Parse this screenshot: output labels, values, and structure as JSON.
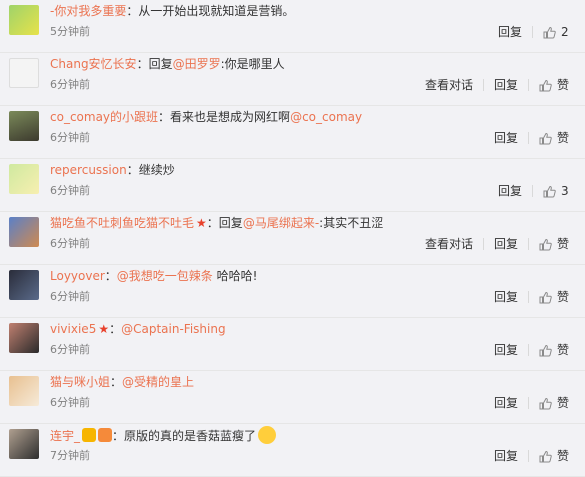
{
  "actions": {
    "view_conversation": "查看对话",
    "reply": "回复",
    "like_label": "赞"
  },
  "comments": [
    {
      "user": "-你对我多重要",
      "sep": "：",
      "content": [
        {
          "t": "plain",
          "v": "从一开始出现就知道是营销。"
        }
      ],
      "time": "5分钟前",
      "likes": "2"
    },
    {
      "user": "Chang安忆长安",
      "sep": "：",
      "content": [
        {
          "t": "plain",
          "v": "回复"
        },
        {
          "t": "mention",
          "v": "@田罗罗"
        },
        {
          "t": "plain",
          "v": ":你是哪里人"
        }
      ],
      "time": "6分钟前",
      "view_conversation": true
    },
    {
      "user": "co_comay的小跟班",
      "sep": "：",
      "content": [
        {
          "t": "plain",
          "v": "看来也是想成为网红啊"
        },
        {
          "t": "mention",
          "v": "@co_comay"
        }
      ],
      "time": "6分钟前"
    },
    {
      "user": "repercussion",
      "sep": "：",
      "content": [
        {
          "t": "plain",
          "v": "继续炒"
        }
      ],
      "time": "6分钟前",
      "likes": "3"
    },
    {
      "user": "猫吃鱼不吐刺鱼吃猫不吐毛",
      "sep": "：",
      "star": true,
      "content": [
        {
          "t": "plain",
          "v": "回复"
        },
        {
          "t": "mention",
          "v": "@马尾绑起来-"
        },
        {
          "t": "plain",
          "v": ":其实不丑涩"
        }
      ],
      "time": "6分钟前",
      "view_conversation": true
    },
    {
      "user": "Loyyover",
      "sep": "：",
      "content": [
        {
          "t": "mention",
          "v": "@我想吃一包辣条"
        },
        {
          "t": "plain",
          "v": " 哈哈哈!"
        }
      ],
      "time": "6分钟前"
    },
    {
      "user": "vivixie5",
      "sep": "：",
      "star": true,
      "content": [
        {
          "t": "mention",
          "v": "@Captain-Fishing"
        }
      ],
      "time": "6分钟前"
    },
    {
      "user": "猫与咪小姐",
      "sep": "：",
      "content": [
        {
          "t": "mention",
          "v": "@受精的皇上"
        }
      ],
      "time": "6分钟前"
    },
    {
      "user": "连宇_",
      "sep": "：",
      "badges": true,
      "content": [
        {
          "t": "plain",
          "v": "原版的真的是香菇蓝瘦了"
        }
      ],
      "emoji": true,
      "time": "7分钟前"
    }
  ],
  "colors": {
    "accent": "#eb7350",
    "background": "#f2f2f5",
    "time": "#808080"
  }
}
